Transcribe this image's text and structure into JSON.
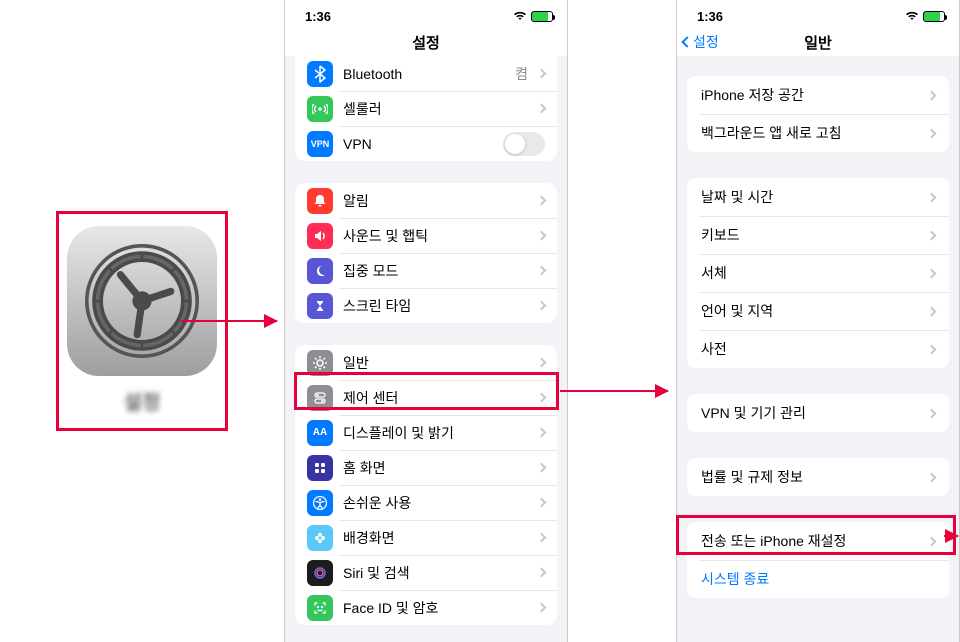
{
  "panel1": {
    "app_name": "설정"
  },
  "statusbar": {
    "time": "1:36"
  },
  "settings_screen": {
    "title": "설정",
    "group1": {
      "bluetooth": {
        "label": "Bluetooth",
        "value": "켬"
      },
      "cellular": {
        "label": "셀룰러"
      },
      "vpn": {
        "label": "VPN"
      }
    },
    "group2": {
      "notifications": {
        "label": "알림"
      },
      "sounds": {
        "label": "사운드 및 햅틱"
      },
      "focus": {
        "label": "집중 모드"
      },
      "screentime": {
        "label": "스크린 타임"
      }
    },
    "group3": {
      "general": {
        "label": "일반"
      },
      "controlcenter": {
        "label": "제어 센터"
      },
      "display": {
        "label": "디스플레이 및 밝기"
      },
      "home": {
        "label": "홈 화면"
      },
      "accessibility": {
        "label": "손쉬운 사용"
      },
      "wallpaper": {
        "label": "배경화면"
      },
      "siri": {
        "label": "Siri 및 검색"
      },
      "faceid": {
        "label": "Face ID 및 암호"
      }
    }
  },
  "general_screen": {
    "back": "설정",
    "title": "일반",
    "group1": {
      "storage": {
        "label": "iPhone 저장 공간"
      },
      "bgrefresh": {
        "label": "백그라운드 앱 새로 고침"
      }
    },
    "group2": {
      "datetime": {
        "label": "날짜 및 시간"
      },
      "keyboard": {
        "label": "키보드"
      },
      "fonts": {
        "label": "서체"
      },
      "language": {
        "label": "언어 및 지역"
      },
      "dictionary": {
        "label": "사전"
      }
    },
    "group3": {
      "vpndevice": {
        "label": "VPN 및 기기 관리"
      }
    },
    "group4": {
      "legal": {
        "label": "법률 및 규제 정보"
      }
    },
    "group5": {
      "transfer": {
        "label": "전송 또는 iPhone 재설정"
      },
      "shutdown": {
        "label": "시스템 종료"
      }
    }
  }
}
